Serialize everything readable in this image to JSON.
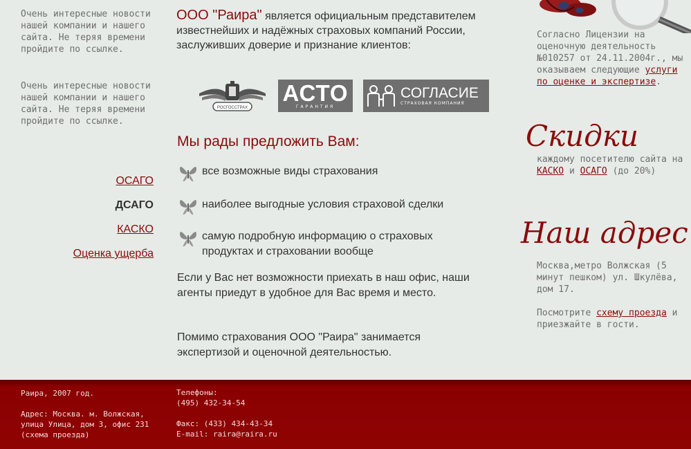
{
  "left": {
    "news": [
      "Очень интересные новости нашей компании и нашего сайта. Не теряя времени пройдите по ссылке.",
      "Очень интересные новости нашей компании и нашего сайта. Не теряя времени пройдите по ссылке."
    ],
    "nav": [
      {
        "label": "ОСАГО",
        "current": false
      },
      {
        "label": "ДСАГО",
        "current": true
      },
      {
        "label": "КАСКО",
        "current": false
      },
      {
        "label": "Оценка ущерба",
        "current": false
      }
    ]
  },
  "center": {
    "intro_brand": "ООО \"Раира\"",
    "intro_rest": " является официальным представителем известнейших и надёжных страховых компаний России, заслуживших доверие и признание клиентов:",
    "logos": {
      "rgs": "РОСГОССТРАХ",
      "asto_big": "АСТО",
      "asto_small": "ГАРАНТИЯ",
      "soglasie_big": "СОГЛАСИЕ",
      "soglasie_small": "СТРАХОВАЯ КОМПАНИЯ"
    },
    "offer_title": "Мы рады предложить Вам:",
    "offers": [
      "все возможные виды страхования",
      "наиболее выгодные условия страховой сделки",
      "самую подробную информацию о страховых продуктах и страховании вообще"
    ],
    "para1": "Если у Вас нет возможности приехать в наш офис, наши агенты приедут  в удобное для Вас время и место.",
    "para2": "Помимо страхования ООО \"Раира\" занимается экспертизой и оценочной деятельностью."
  },
  "right": {
    "license_text": "Согласно Лицензии на оценочную деятельность №010257 от 24.11.2004г., мы оказываем следующие ",
    "license_link": "услуги по оценке и экспертизе",
    "license_end": ".",
    "skidki_title": "Скидки",
    "skidki_text": "каждому посетителю сайта на ",
    "skidki_link1": "КАСКО",
    "skidki_and": " и ",
    "skidki_link2": "ОСАГО",
    "skidki_end": " (до 20%)",
    "adres_title": "Наш адрес",
    "adres_text": "Москва,метро Волжская (5 минут пешком) ул. Шкулёва, дом 17.",
    "adres_see": "Посмотрите ",
    "adres_link": "схему проезда",
    "adres_end": " и приезжайте в гости."
  },
  "footer": {
    "copyright": "Раира, 2007 год.",
    "address": "Адрес: Москва. м. Волжская, улица Улица, дом 3, офис 231",
    "scheme": "(схема проезда)",
    "phones_label": "Телефоны:",
    "phone": "(495) 432-34-54",
    "fax": "Факс: (433) 434-43-34",
    "email": "E-mail: raira@raira.ru"
  },
  "colors": {
    "accent": "#8c0a0a",
    "background": "#e6ebe8",
    "footer": "#8f0303",
    "text": "#333333",
    "muted": "#6e6e6e"
  },
  "icons": {
    "bullet": "butterfly-icon",
    "decor": "magnifier-butterfly-icon"
  }
}
